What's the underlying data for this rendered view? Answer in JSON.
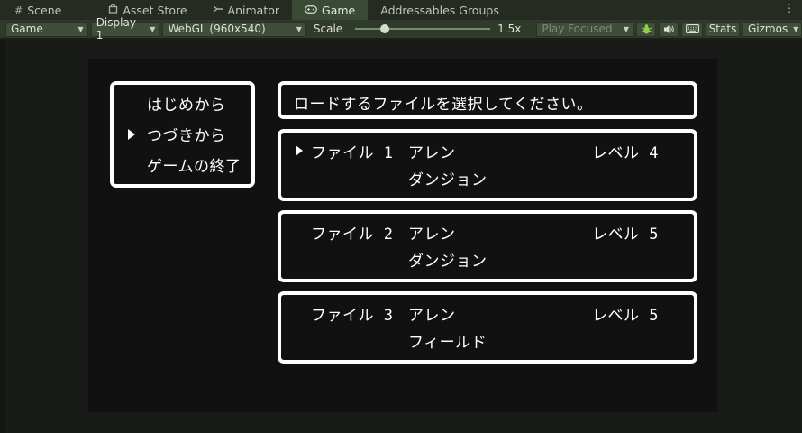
{
  "tabs": [
    {
      "label": "Scene",
      "icon": "hash-grid-icon",
      "active": false
    },
    {
      "label": "Asset Store",
      "icon": "shopping-bag-icon",
      "active": false
    },
    {
      "label": "Animator",
      "icon": "animator-icon",
      "active": false
    },
    {
      "label": "Game",
      "icon": "gamepad-icon",
      "active": true
    },
    {
      "label": "Addressables Groups",
      "icon": "",
      "active": false
    }
  ],
  "toolbar": {
    "view_mode": "Game",
    "display": "Display 1",
    "resolution": "WebGL (960x540)",
    "scale_label": "Scale",
    "scale_value": "1.5x",
    "scale_fraction": 0.2,
    "play_mode": "Play Focused",
    "stats_label": "Stats",
    "gizmos_label": "Gizmos"
  },
  "game": {
    "menu": {
      "items": [
        "はじめから",
        "つづきから",
        "ゲームの終了"
      ],
      "selected_index": 1
    },
    "prompt": "ロードするファイルを選択してください。",
    "slots": [
      {
        "file": "ファイル 1",
        "name": "アレン",
        "level": "レベル 4",
        "location": "ダンジョン",
        "selected": true
      },
      {
        "file": "ファイル 2",
        "name": "アレン",
        "level": "レベル 5",
        "location": "ダンジョン",
        "selected": false
      },
      {
        "file": "ファイル 3",
        "name": "アレン",
        "level": "レベル 5",
        "location": "フィールド",
        "selected": false
      }
    ]
  },
  "colors": {
    "active_tab": "#3a4a34",
    "toolbar": "#2f3a2b",
    "game_bg": "#111111",
    "window_border": "#ffffff"
  }
}
